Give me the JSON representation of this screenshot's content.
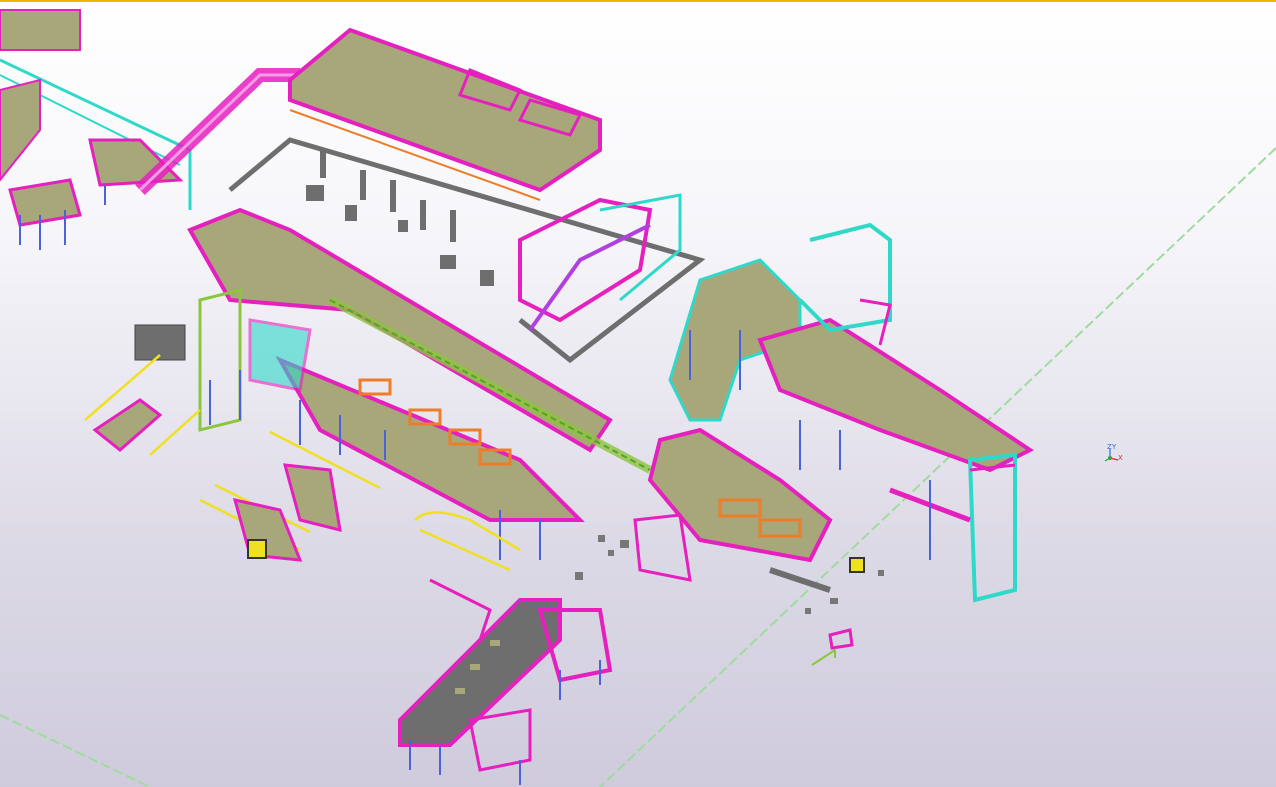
{
  "app": {
    "view": "3D model view"
  },
  "colors": {
    "accent_top": "#f5b400",
    "steel_magenta": "#e61fbf",
    "steel_cyan": "#2fd9c9",
    "steel_blue": "#4b63d8",
    "steel_green": "#8cc63f",
    "slab_olive": "#a7a77a",
    "concrete_gray": "#6e6e6e",
    "rail_yellow": "#f0e020",
    "pile_orange": "#ee7d2a",
    "gridline": "#9edc9e"
  },
  "axis": {
    "y_label": "Y",
    "z_label": "Z",
    "x_label": "X"
  },
  "icons": {
    "axis_gizmo": "xyz-axis-icon"
  }
}
